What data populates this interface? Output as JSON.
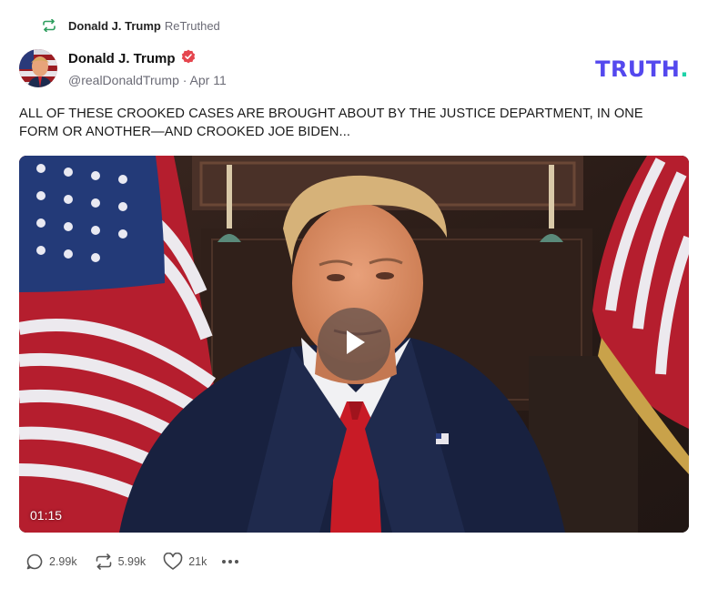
{
  "retruth": {
    "icon": "retruth-icon",
    "name": "Donald J. Trump",
    "label": "ReTruthed"
  },
  "post": {
    "author": {
      "display_name": "Donald J. Trump",
      "verified_icon": "verified-badge-icon",
      "handle": "@realDonaldTrump",
      "separator": "·",
      "date": "Apr 11"
    },
    "brand": {
      "logo_text": "TRUTH",
      "logo_dot": ".",
      "color": "#5448ee",
      "dot_color": "#1cd3a8"
    },
    "text": "ALL OF THESE CROOKED CASES ARE BROUGHT ABOUT BY THE JUSTICE DEPARTMENT, IN ONE FORM OR ANOTHER—AND CROOKED JOE BIDEN...",
    "video": {
      "duration": "01:15",
      "play_icon": "play-icon"
    },
    "actions": {
      "replies": "2.99k",
      "retruths": "5.99k",
      "likes": "21k",
      "reply_icon": "comment-icon",
      "retruth_icon": "retruth-icon",
      "like_icon": "heart-icon",
      "more_icon": "more-options-icon"
    }
  }
}
